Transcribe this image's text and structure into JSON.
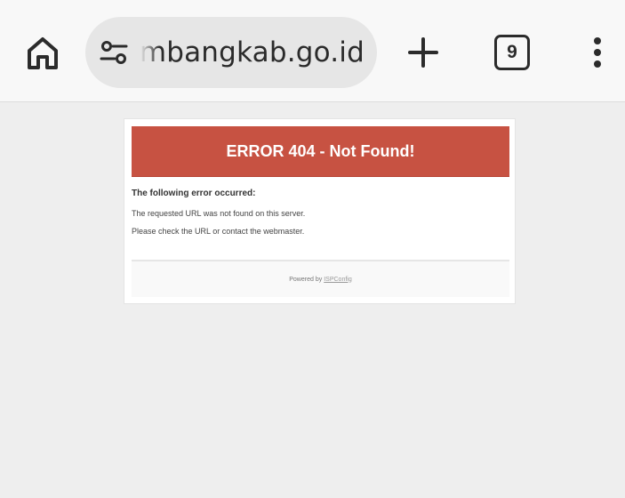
{
  "browser": {
    "url_visible": "embangkab.go.id",
    "tab_count": "9",
    "icons": {
      "home": "home-icon",
      "site_settings": "tune-icon",
      "new_tab": "plus-icon",
      "tabs": "tab-switcher-icon",
      "menu": "more-vert-icon"
    }
  },
  "page": {
    "banner_title": "ERROR 404 - Not Found!",
    "heading": "The following error occurred:",
    "line1": "The requested URL was not found on this server.",
    "line2": "Please check the URL or contact the webmaster.",
    "footer_prefix": "Powered by",
    "footer_link": "ISPConfig"
  },
  "colors": {
    "banner": "#c75242",
    "background": "#eeeeee",
    "toolbar": "#f8f8f8"
  }
}
